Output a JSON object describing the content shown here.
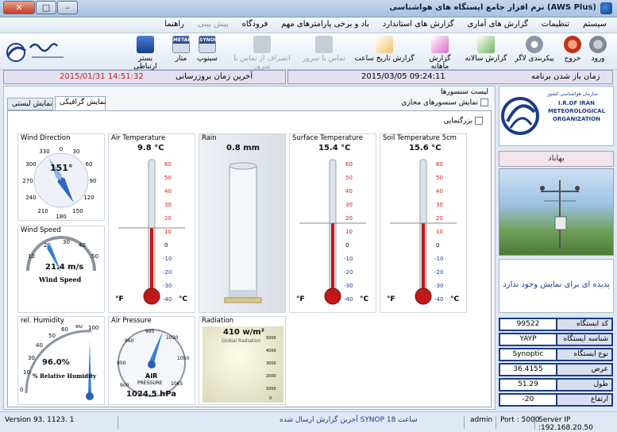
{
  "window": {
    "title": "نرم افزار جامع ایستگاه های هواشناسی (AWS Plus)"
  },
  "menu": [
    "سیستم",
    "تنظیمات",
    "گزارش های آماری",
    "گزارش های استاندارد",
    "باد و برخی پارامترهای مهم",
    "فرودگاه",
    "پیش بینی",
    "راهنما"
  ],
  "toolbar": {
    "login": "ورود",
    "exit": "خروج",
    "logger": "پیکربندی لاگر",
    "yearly": "گزارش سالانه",
    "monthly": "گزارش ماهانه",
    "hour": "گزارش تاریخ ساعت",
    "disconnect": "انصراف از تماس با سرور",
    "connect": "تماس با سرور",
    "synop": "سینوپ",
    "metar": "متار",
    "comm": "بستر ارتباطی",
    "synop_tag": "SYNOP",
    "metar_tag": "METAR"
  },
  "header": {
    "last_update_label": "آخرین زمان بروزرسانی",
    "last_update": "2015/01/31 14:51:32",
    "start_label": "زمان باز شدن برنامه",
    "start": "2015/03/05 09:24:11"
  },
  "panel": {
    "sensor_list": "لیست سنسورها",
    "virtual_sensors": "نمایش سنسورهای مجازی",
    "tab_graphic": "نمایش گرافیکی",
    "tab_text": "نمایش لیستی",
    "zoom": "بزرگنمایی"
  },
  "gauges": {
    "wind_dir": {
      "title": "Wind Direction",
      "value": "151°",
      "deg": 151
    },
    "air_temp": {
      "title": "Air Temperature",
      "value": "9.8 °C",
      "temp": 9.8
    },
    "rain": {
      "title": "Rain",
      "value": "0.8 mm"
    },
    "surf_temp": {
      "title": "Surface Temperature",
      "value": "15.4 °C",
      "temp": 15.4
    },
    "soil_temp": {
      "title": "Soil Temperature 5cm",
      "value": "15.6 °C",
      "temp": 15.6
    },
    "wind_speed": {
      "title": "Wind Speed",
      "value": "21.4 m/s",
      "label": "Wind Speed",
      "speed": 21.4
    },
    "humidity": {
      "title": "rel. Humidity",
      "value": "96.0%",
      "label": "% Relative Humidity",
      "hum": 96
    },
    "pressure": {
      "title": "Air Pressure",
      "value": "1024.5 hPa",
      "label": "AIR",
      "label2": "PRESSURE",
      "hpa": 1024.5
    },
    "radiation": {
      "title": "Radiation",
      "value": "410 w/m²",
      "label": "Global Radiation",
      "rad": 410
    }
  },
  "station": {
    "org": "سازمان هواشناسی کشور",
    "org_en": "I.R.OF IRAN METEOROLOGICAL ORGANIZATION",
    "name": "بهاباد",
    "phenomena": "پدیده ای برای نمایش وجود ندارد",
    "info": [
      {
        "k": "کد ایستگاه",
        "v": "99522"
      },
      {
        "k": "شناسه ایستگاه",
        "v": "YAYP"
      },
      {
        "k": "نوع ایستگاه",
        "v": "Synoptic"
      },
      {
        "k": "عرض",
        "v": "36.4155"
      },
      {
        "k": "طول",
        "v": "51.29"
      },
      {
        "k": "ارتفاع",
        "v": "-20"
      }
    ]
  },
  "status": {
    "version": "Version 93. 1123. 1",
    "synop": "آخرین گزارش ارسال شده SYNOP ساعت 18",
    "user": "admin",
    "port": "Port : 5000",
    "server": "Server IP :192.168.20.50"
  },
  "colors": {
    "red": "#d01818",
    "blue": "#1a3b8c",
    "accent": "#3a7fd5"
  }
}
